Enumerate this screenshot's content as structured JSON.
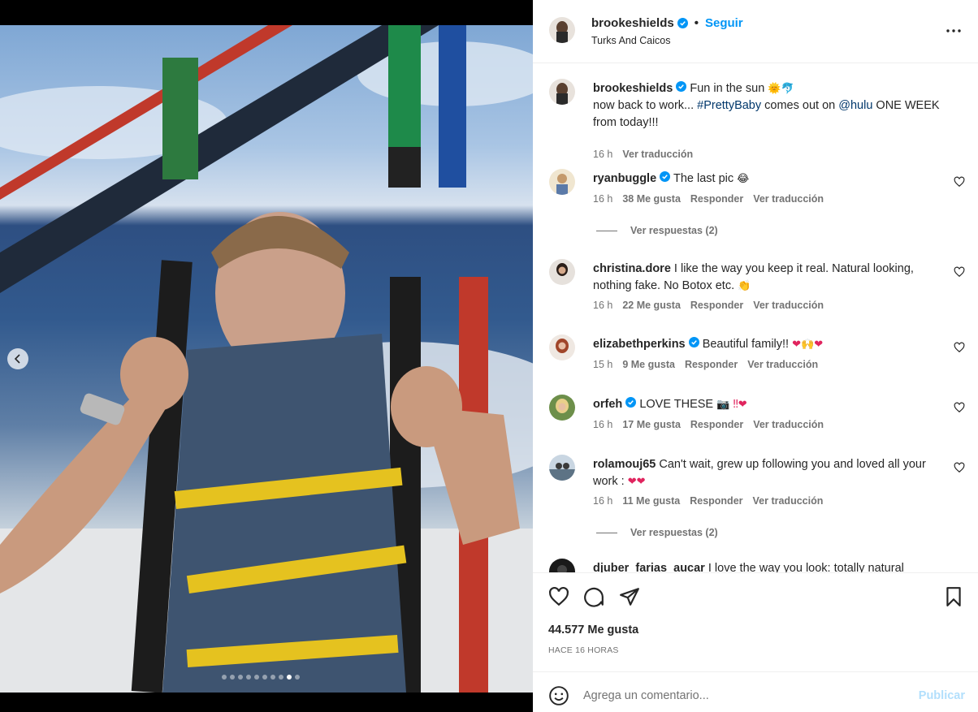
{
  "post": {
    "username": "brookeshields",
    "follow_label": "Seguir",
    "location": "Turks And Caicos",
    "caption_text": "Fun in the sun",
    "caption_emoji": "🌞🐬",
    "caption_line2_pre": "now back to work... ",
    "caption_hashtag": "#PrettyBaby",
    "caption_mid": " comes out on ",
    "caption_mention": "@hulu",
    "caption_post": " ONE WEEK from today!!!",
    "caption_time": "16 h",
    "caption_translate": "Ver traducción"
  },
  "comments": [
    {
      "user": "ryanbuggle",
      "verified": true,
      "text": "The last pic",
      "emoji": "😂",
      "time": "16 h",
      "likes": "38 Me gusta",
      "reply": "Responder",
      "translate": "Ver traducción",
      "replies_label": "Ver respuestas (2)"
    },
    {
      "user": "christina.dore",
      "verified": false,
      "text": "I like the way you keep it real. Natural looking, nothing fake. No Botox etc.",
      "emoji": "👏",
      "time": "16 h",
      "likes": "22 Me gusta",
      "reply": "Responder",
      "translate": "Ver traducción"
    },
    {
      "user": "elizabethperkins",
      "verified": true,
      "text": "Beautiful family!!",
      "emoji": "❤🙌❤",
      "time": "15 h",
      "likes": "9 Me gusta",
      "reply": "Responder",
      "translate": "Ver traducción"
    },
    {
      "user": "orfeh",
      "verified": true,
      "text": "LOVE THESE",
      "emoji": "📷 ‼❤",
      "time": "16 h",
      "likes": "17 Me gusta",
      "reply": "Responder",
      "translate": "Ver traducción"
    },
    {
      "user": "rolamouj65",
      "verified": false,
      "text": "Can't wait, grew up following you and loved all your work :",
      "emoji": "❤❤",
      "time": "16 h",
      "likes": "11 Me gusta",
      "reply": "Responder",
      "translate": "Ver traducción",
      "replies_label": "Ver respuestas (2)"
    },
    {
      "user": "djuber_farias_aucar",
      "verified": false,
      "text": "I love the way you look: totally natural"
    }
  ],
  "footer": {
    "likes": "44.577 Me gusta",
    "posted": "HACE 16 HORAS",
    "comment_placeholder": "Agrega un comentario...",
    "publish_label": "Publicar"
  },
  "icons": {
    "carousel_prev": "chevron-left-icon",
    "more": "more-horizontal-icon",
    "like": "heart-icon",
    "comment": "comment-icon",
    "share": "share-icon",
    "save": "bookmark-icon",
    "emoji": "emoji-icon",
    "verified": "verified-badge-icon"
  },
  "carousel": {
    "total": 10,
    "active": 9
  },
  "colors": {
    "accent": "#0095f6",
    "link": "#00376b",
    "muted": "#737373",
    "verified": "#0095f6",
    "heart": "#ed1c24"
  }
}
